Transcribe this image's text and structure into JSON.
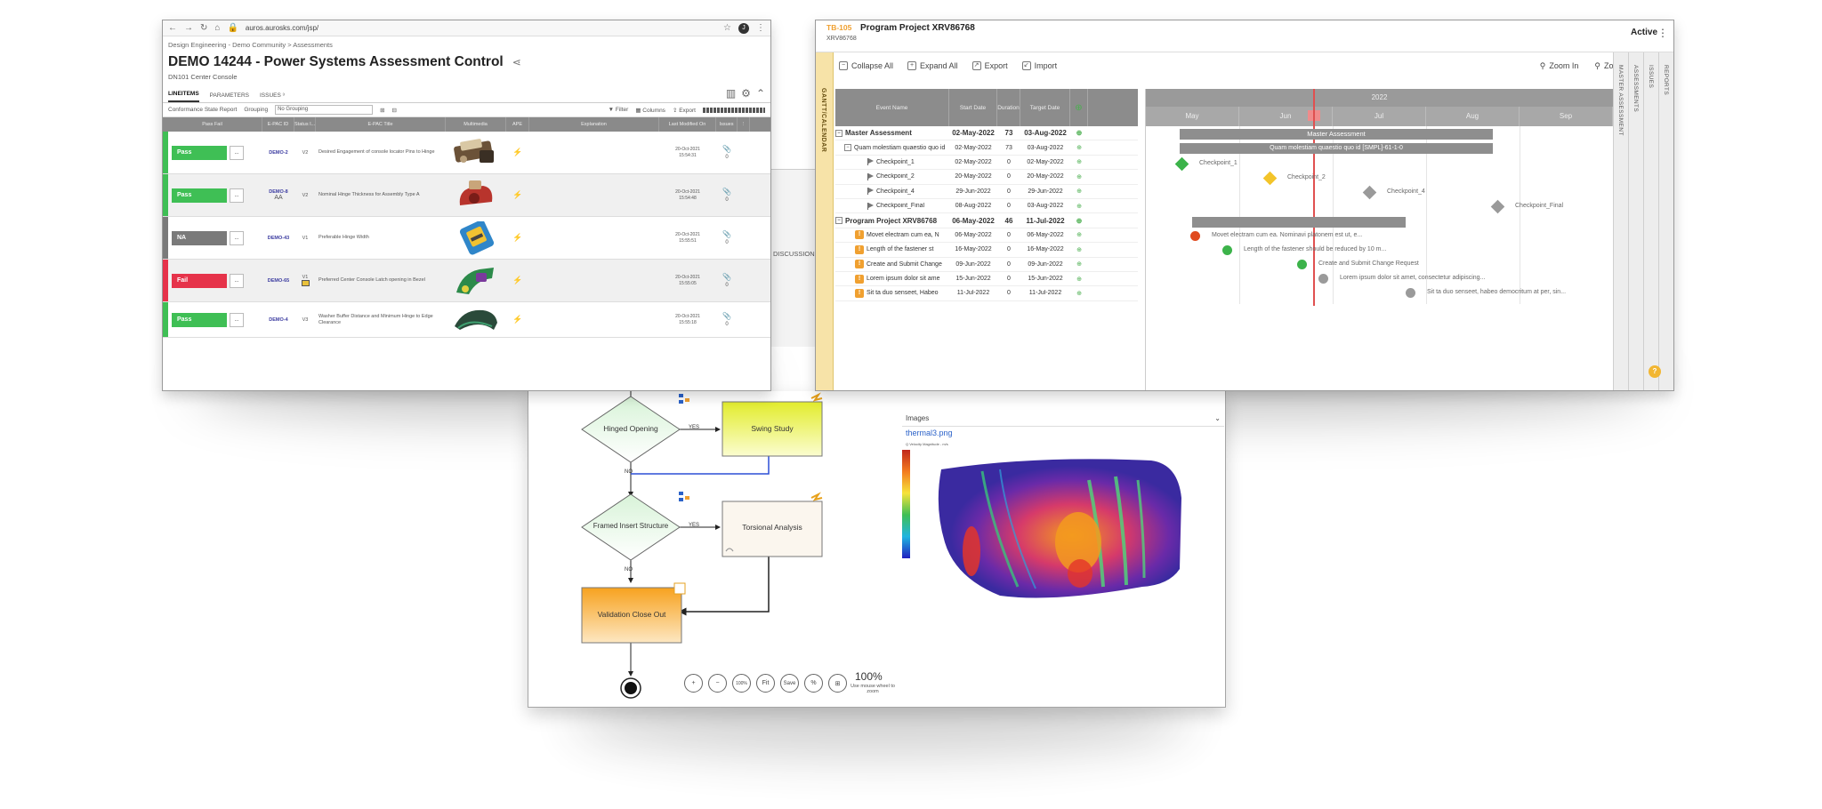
{
  "browser": {
    "url": "auros.aurosks.com/jsp/",
    "breadcrumb": "Design Engineering - Demo Community > Assessments",
    "title": "DEMO 14244 - Power Systems Assessment Control",
    "subtitle": "DN101 Center Console",
    "tabs": [
      {
        "label": "LINEITEMS"
      },
      {
        "label": "PARAMETERS"
      },
      {
        "label": "ISSUES ³"
      }
    ],
    "toolbar": {
      "report": "Conformance State Report",
      "grouping_label": "Grouping",
      "grouping_value": "No Grouping",
      "filter": "Filter",
      "columns": "Columns",
      "export": "Export"
    },
    "columns": [
      "Pass Fail",
      "E-PAC ID",
      "Status I...",
      "E-PAC Title",
      "Multimedia",
      "APE",
      "Explanation",
      "Last Modified On",
      "Issues"
    ],
    "rows": [
      {
        "status": "Pass",
        "color": "#3fbf55",
        "id": "DEMO-2",
        "ver": "V2",
        "title": "Desired Engagement of console locator Pins to Hinge",
        "date": "20-Oct-2021",
        "time": "15:54:31",
        "issues": "0"
      },
      {
        "status": "Pass",
        "color": "#3fbf55",
        "id": "DEMO-8",
        "sub": "AA",
        "ver": "V2",
        "title": "Nominal Hinge Thickness for Assembly Type A",
        "date": "20-Oct-2021",
        "time": "15:54:48",
        "issues": "0"
      },
      {
        "status": "NA",
        "color": "#7a7a7a",
        "id": "DEMO-43",
        "ver": "V1",
        "title": "Preferable Hinge Width",
        "date": "20-Oct-2021",
        "time": "15:55:51",
        "issues": "0"
      },
      {
        "status": "Fail",
        "color": "#e6334a",
        "id": "DEMO-65",
        "ver": "V1",
        "title": "Preferred Center Console Latch opening in Bezel",
        "date": "20-Oct-2021",
        "time": "15:55:05",
        "issues": "0"
      },
      {
        "status": "Pass",
        "color": "#3fbf55",
        "id": "DEMO-4",
        "ver": "V3",
        "title": "Washer Buffer Distance and Minimum Hinge to Edge Clearance",
        "date": "20-Oct-2021",
        "time": "15:55:18",
        "issues": "0"
      }
    ],
    "more_label": "...",
    "discussion_label": "DISCUSSION"
  },
  "gantt": {
    "id": "TB-105",
    "title": "Program Project XRV86768",
    "subtitle": "XRV86768",
    "status": "Active",
    "side_tab": "GANTT/CALENDAR",
    "toolbar": {
      "collapse": "Collapse All",
      "expand": "Expand All",
      "export": "Export",
      "import": "Import",
      "zoom_in": "Zoom In",
      "zoom_out": "Zoom Out"
    },
    "columns": [
      "Event Name",
      "Start Date",
      "Duration",
      "Target Date"
    ],
    "year": "2022",
    "months": [
      "May",
      "Jun",
      "Jul",
      "Aug",
      "Sep"
    ],
    "right_tabs": [
      "MASTER ASSESSMENT",
      "ASSESSMENTS",
      "ISSUES",
      "REPORTS"
    ],
    "rows": [
      {
        "name": "Master Assessment",
        "start": "02-May-2022",
        "dur": "73",
        "target": "03-Aug-2022",
        "kind": "group"
      },
      {
        "name": "Quam molestiam quaestio quo id",
        "start": "02-May-2022",
        "dur": "73",
        "target": "03-Aug-2022",
        "kind": "sub"
      },
      {
        "name": "Checkpoint_1",
        "start": "02-May-2022",
        "dur": "0",
        "target": "02-May-2022",
        "kind": "flag"
      },
      {
        "name": "Checkpoint_2",
        "start": "20-May-2022",
        "dur": "0",
        "target": "20-May-2022",
        "kind": "flag"
      },
      {
        "name": "Checkpoint_4",
        "start": "29-Jun-2022",
        "dur": "0",
        "target": "29-Jun-2022",
        "kind": "flag"
      },
      {
        "name": "Checkpoint_Final",
        "start": "08-Aug-2022",
        "dur": "0",
        "target": "03-Aug-2022",
        "kind": "flag"
      },
      {
        "name": "Program Project XRV86768",
        "start": "06-May-2022",
        "dur": "46",
        "target": "11-Jul-2022",
        "kind": "group"
      },
      {
        "name": "Movet electram cum ea, N",
        "start": "06-May-2022",
        "dur": "0",
        "target": "06-May-2022",
        "kind": "warn"
      },
      {
        "name": "Length of the fastener st",
        "start": "16-May-2022",
        "dur": "0",
        "target": "16-May-2022",
        "kind": "warn"
      },
      {
        "name": "Create and Submit Change",
        "start": "09-Jun-2022",
        "dur": "0",
        "target": "09-Jun-2022",
        "kind": "warn"
      },
      {
        "name": "Lorem ipsum dolor sit ame",
        "start": "15-Jun-2022",
        "dur": "0",
        "target": "15-Jun-2022",
        "kind": "warn"
      },
      {
        "name": "Sit ta duo senseet, Habeo",
        "start": "11-Jul-2022",
        "dur": "0",
        "target": "11-Jul-2022",
        "kind": "warn"
      }
    ],
    "bar_labels": {
      "master": "Master Assessment",
      "sub": "Quam molestiam quaestio quo id [SMPL]-61-1-0"
    },
    "milestone_labels": [
      "Checkpoint_1",
      "Checkpoint_2",
      "Checkpoint_4",
      "Checkpoint_Final",
      "Movet electram cum ea. Nominavi platonem est ut, e...",
      "Length of the fastener should be reduced by 10 m...",
      "Create and Submit Change Request",
      "Lorem ipsum dolor sit amet, consectetur adipiscing...",
      "Sit ta duo senseet, habeo democritum at per, sin..."
    ],
    "milestone_colors": {
      "green": "#3cb34a",
      "yellow": "#f3c42a",
      "gray": "#9a9a9a",
      "red": "#e04a1f"
    },
    "hint_icon": "?"
  },
  "flow": {
    "nodes": {
      "hinged": "Hinged Opening",
      "swing": "Swing Study",
      "framed": "Framed Insert Structure",
      "torsional": "Torsional Analysis",
      "validation": "Validation Close Out"
    },
    "edge_yes": "YES",
    "edge_no": "NO",
    "images_label": "Images",
    "image_name": "thermal3.png",
    "image_caption": "Q Velocity Magnitude - m/s",
    "zoom_buttons": [
      "+",
      "−",
      "100%",
      "Fit",
      "Save",
      "%",
      "⊞"
    ],
    "zoom_value": "100%",
    "zoom_hint": "Use mouse wheel to zoom"
  }
}
